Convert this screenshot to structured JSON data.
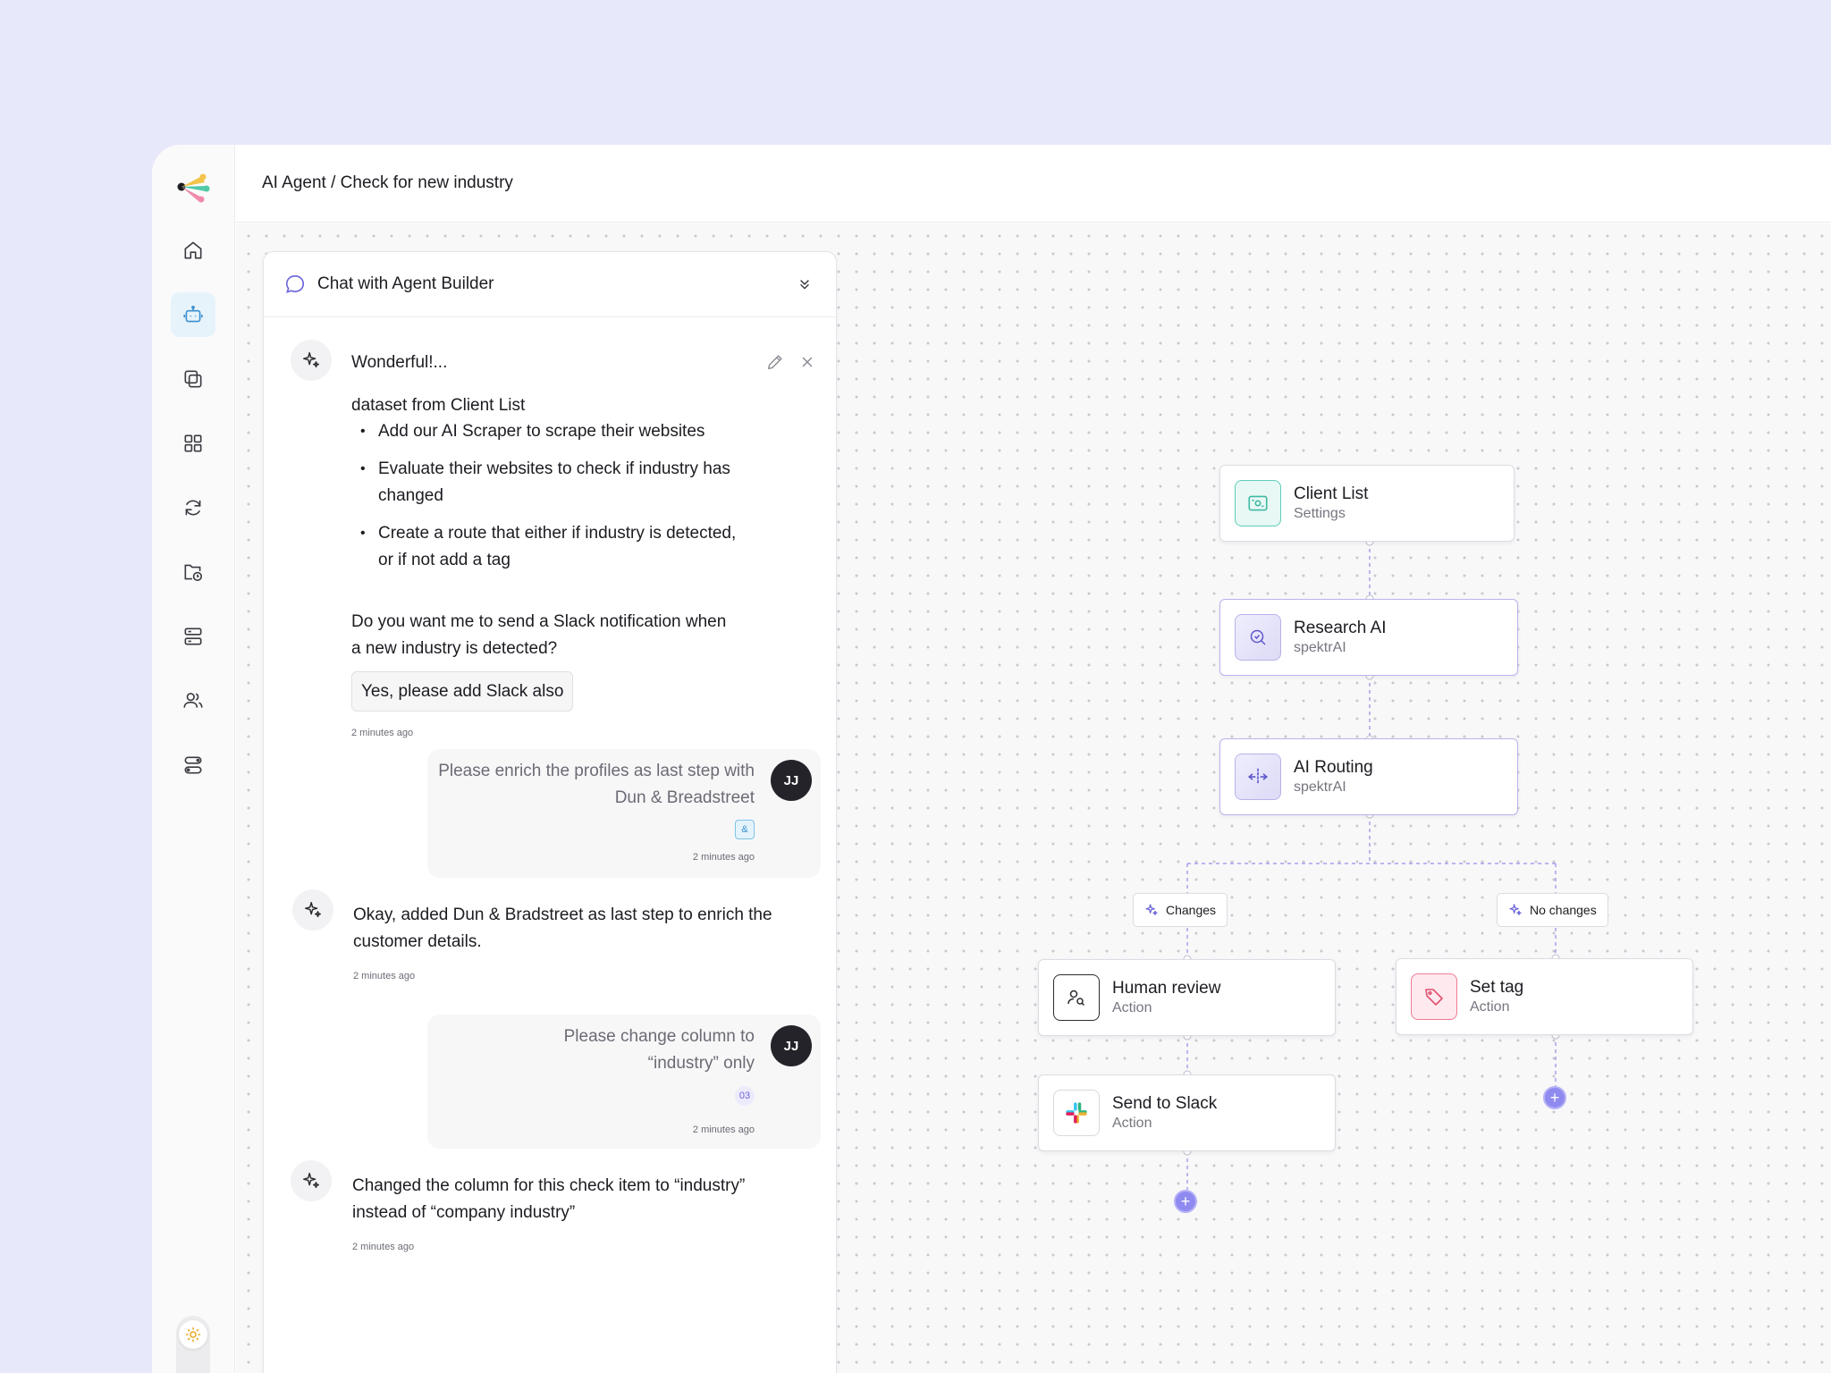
{
  "breadcrumb": "AI Agent / Check for new industry",
  "chat": {
    "title": "Chat with Agent Builder",
    "messages": {
      "m1_title": "Wonderful!...",
      "m1_intro": "dataset from Client List",
      "m1_bullets": [
        "Add our AI Scraper to scrape their websites",
        "Evaluate their websites to check if industry has changed",
        "Create a route that either if industry is detected, or if not add a tag"
      ],
      "m1_question": "Do you want me to send a Slack notification when a new industry is detected?",
      "m1_reply": "Yes, please add Slack also",
      "m1_time": "2 minutes ago",
      "u1_text": "Please enrich the profiles as last step with Dun & Breadstreet",
      "u1_attach": "&",
      "u1_time": "2 minutes ago",
      "u1_avatar": "JJ",
      "m2_text": "Okay, added Dun & Bradstreet as last step to enrich the customer details.",
      "m2_time": "2 minutes ago",
      "u2_text": "Please change column to “industry” only",
      "u2_attach": "03",
      "u2_time": "2 minutes ago",
      "u2_avatar": "JJ",
      "m3_text": "Changed the column for this check item to “industry” instead of “company industry”",
      "m3_time": "2 minutes ago"
    }
  },
  "flow": {
    "nodes": {
      "client_list": {
        "title": "Client List",
        "sub": "Settings",
        "icon": "settings-icon"
      },
      "research_ai": {
        "title": "Research AI",
        "sub": "spektrAI",
        "icon": "research-icon"
      },
      "ai_routing": {
        "title": "AI Routing",
        "sub": "spektrAI",
        "icon": "routing-icon"
      },
      "human_review": {
        "title": "Human review",
        "sub": "Action",
        "icon": "user-search-icon"
      },
      "set_tag": {
        "title": "Set tag",
        "sub": "Action",
        "icon": "tag-icon"
      },
      "send_slack": {
        "title": "Send to Slack",
        "sub": "Action",
        "icon": "slack-icon"
      }
    },
    "branches": {
      "left": "Changes",
      "right": "No changes"
    },
    "add_symbol": "+"
  },
  "colors": {
    "accent_purple": "#8f8af0",
    "teal": "#5fcdb9",
    "pink": "#ef7b95",
    "active_nav": "#e7f3fb"
  },
  "sidebar": {
    "items": [
      "home-icon",
      "agent-icon",
      "copy-icon",
      "grid-icon",
      "refresh-icon",
      "folder-clock-icon",
      "database-icon",
      "users-icon",
      "routes-icon"
    ],
    "active_index": 1
  }
}
